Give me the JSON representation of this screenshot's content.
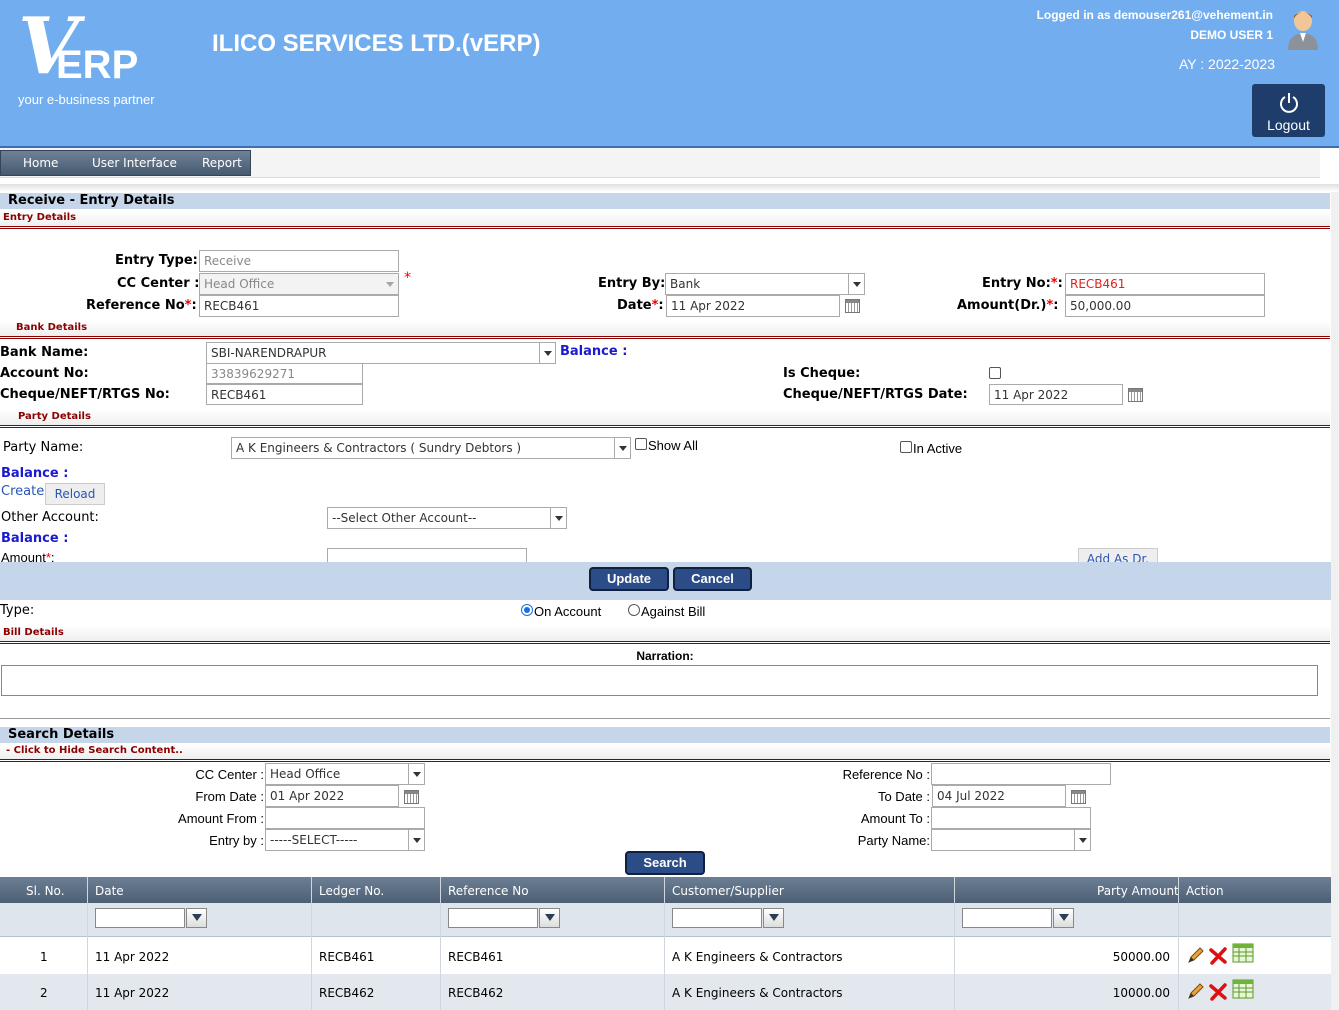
{
  "header": {
    "logo_mark": "V",
    "logo_text": "ERP",
    "tagline": "your e-business partner",
    "app_title": "ILICO SERVICES LTD.(vERP)",
    "logged_in": "Logged in as demouser261@vehement.in",
    "user_name": "DEMO USER 1",
    "academic_year": "AY : 2022-2023",
    "logout_label": "Logout"
  },
  "menu": [
    "Home",
    "User Interface",
    "Report"
  ],
  "page_title": "Receive - Entry Details",
  "entry_details": {
    "heading": "Entry Details",
    "entry_type_label": "Entry Type:",
    "entry_type_value": "Receive",
    "cc_center_label": "CC Center :",
    "cc_center_value": "Head Office",
    "reference_no_label": "Reference No",
    "reference_no_value": "RECB461",
    "entry_by_label": "Entry By:",
    "entry_by_value": "Bank",
    "date_label": "Date",
    "date_value": "11 Apr 2022",
    "entry_no_label": "Entry No:",
    "entry_no_value": "RECB461",
    "amount_label": "Amount(Dr.)",
    "amount_value": "50,000.00",
    "required_mark": "*"
  },
  "bank_details": {
    "heading": "Bank Details",
    "bank_name_label": "Bank Name:",
    "bank_name_value": "SBI-NARENDRAPUR",
    "balance_label": "Balance :",
    "account_no_label": "Account No:",
    "account_no_value": "33839629271",
    "cheque_no_label": "Cheque/NEFT/RTGS No:",
    "cheque_no_value": "RECB461",
    "is_cheque_label": "Is Cheque:",
    "cheque_date_label": "Cheque/NEFT/RTGS Date:",
    "cheque_date_value": "11 Apr 2022"
  },
  "party_details": {
    "heading": "Party Details",
    "party_name_label": "Party Name:",
    "party_name_value": "A K Engineers & Contractors ( Sundry Debtors )",
    "show_all_label": "Show All",
    "in_active_label": "In Active",
    "balance_label": "Balance :",
    "create_label": "Create",
    "reload_label": "Reload",
    "other_account_label": "Other Account:",
    "other_account_value": "--Select Other Account--",
    "balance2_label": "Balance :",
    "amount_label": "Amount",
    "add_as_dr_label": "Add As Dr."
  },
  "actions": {
    "update": "Update",
    "cancel": "Cancel"
  },
  "type": {
    "label": "Type:",
    "on_account": "On Account",
    "against_bill": "Against Bill",
    "selected": "On Account"
  },
  "bill_details": {
    "heading": "Bill Details",
    "narration_label": "Narration:"
  },
  "search": {
    "title": "Search Details",
    "hide_link": "- Click to Hide Search Content..",
    "cc_center_label": "CC Center :",
    "cc_center_value": "Head Office",
    "from_date_label": "From Date :",
    "from_date_value": "01 Apr 2022",
    "amount_from_label": "Amount From :",
    "entry_by_label": "Entry by :",
    "entry_by_value": "-----SELECT-----",
    "reference_no_label": "Reference No :",
    "to_date_label": "To Date :",
    "to_date_value": "04 Jul 2022",
    "amount_to_label": "Amount To :",
    "party_name_label": "Party Name:",
    "search_button": "Search"
  },
  "grid": {
    "columns": [
      "Sl. No.",
      "Date",
      "Ledger No.",
      "Reference No",
      "Customer/Supplier",
      "Party Amount",
      "Action"
    ],
    "rows": [
      {
        "sl": "1",
        "date": "11 Apr 2022",
        "ledger": "RECB461",
        "ref": "RECB461",
        "party": "A K Engineers & Contractors",
        "amount": "50000.00"
      },
      {
        "sl": "2",
        "date": "11 Apr 2022",
        "ledger": "RECB462",
        "ref": "RECB462",
        "party": "A K Engineers & Contractors",
        "amount": "10000.00"
      }
    ]
  },
  "colors": {
    "header_bg": "#72aeef",
    "required": "#e00000",
    "balance": "#1a1ad0",
    "section_red": "#8b0000"
  }
}
